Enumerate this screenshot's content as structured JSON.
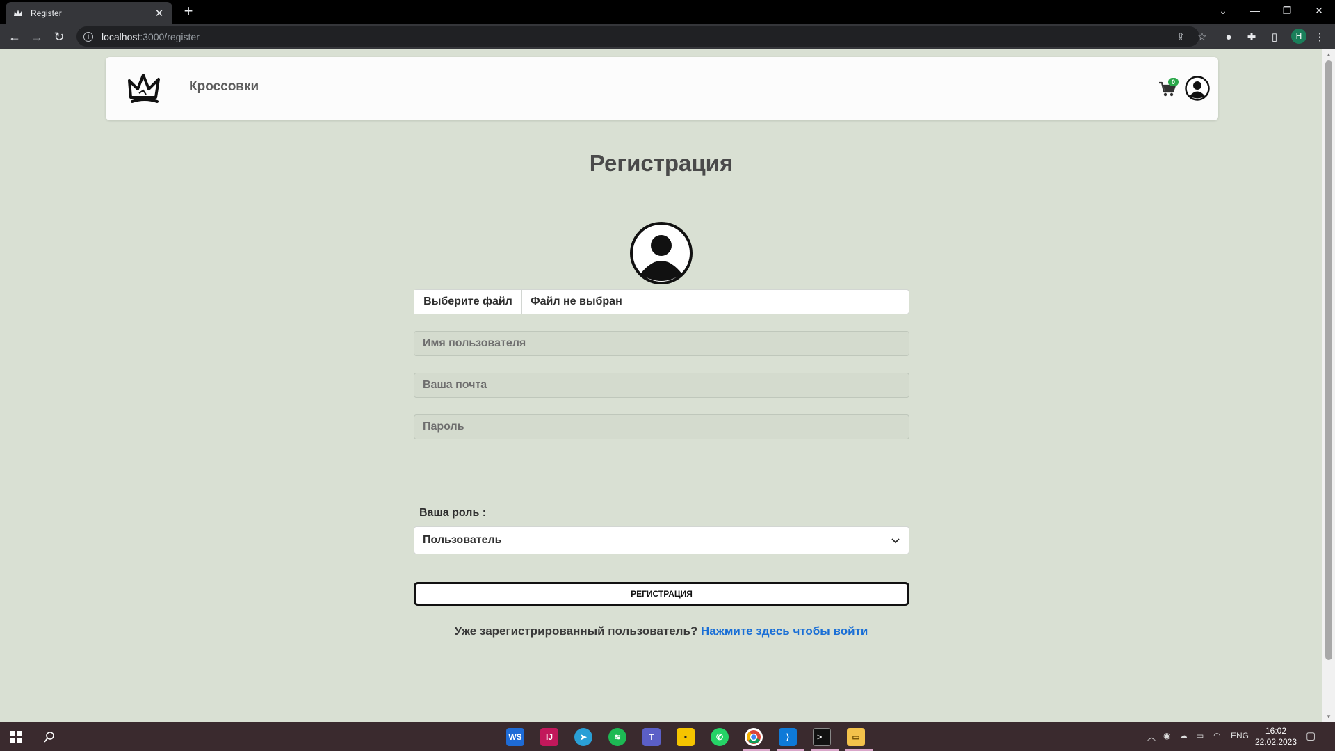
{
  "browser": {
    "tab_title": "Register",
    "url_host": "localhost",
    "url_path": ":3000/register",
    "profile_initial": "H"
  },
  "site": {
    "brand": "Кроссовки",
    "cart_count": "0"
  },
  "page": {
    "title": "Регистрация"
  },
  "form": {
    "file_button": "Выберите файл",
    "file_status": "Файл не выбран",
    "username_placeholder": "Имя пользователя",
    "email_placeholder": "Ваша почта",
    "password_placeholder": "Пароль",
    "role_label": "Ваша роль :",
    "role_selected": "Пользователь",
    "submit_label": "РЕГИСТРАЦИЯ",
    "login_prompt": "Уже зарегистрированный пользователь?",
    "login_link": "Нажмите здесь чтобы войти"
  },
  "taskbar": {
    "language": "ENG",
    "time": "16:02",
    "date": "22.02.2023",
    "apps": [
      "webstorm",
      "intellij",
      "telegram",
      "spotify",
      "teams",
      "sticky-notes",
      "whatsapp",
      "chrome",
      "vscode",
      "terminal",
      "file-explorer"
    ]
  },
  "colors": {
    "page_bg": "#d9e0d3",
    "link": "#1a6fd6",
    "badge": "#2aa84a"
  }
}
